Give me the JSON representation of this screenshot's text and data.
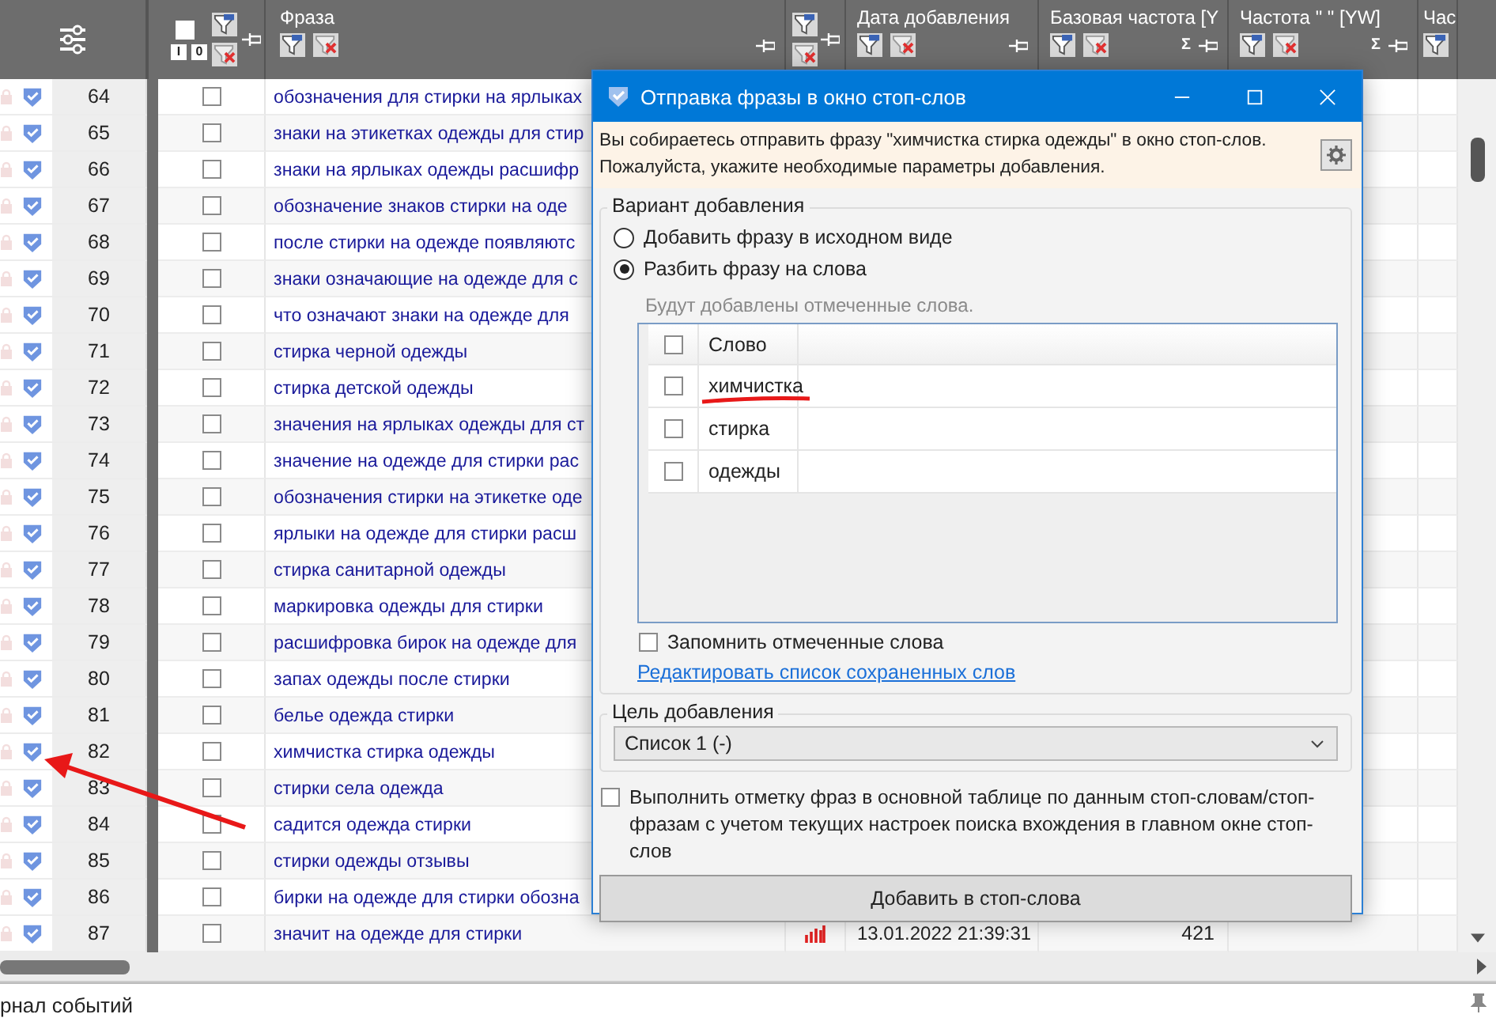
{
  "main_table": {
    "check_header": {
      "checked": false,
      "buttons": [
        "I",
        "0"
      ]
    },
    "columns": [
      {
        "label": "Фраза"
      },
      {
        "label": "Дата добавления"
      },
      {
        "label": "Базовая частота [Y",
        "sum": "Σ"
      },
      {
        "label": "Частота \" \" [YW]",
        "sum": "Σ"
      },
      {
        "label": "Час"
      }
    ],
    "rows": [
      {
        "number": "64",
        "checked": false,
        "phrase": "обозначения для стирки на ярлыках"
      },
      {
        "number": "65",
        "checked": false,
        "phrase": "знаки на этикетках одежды для стир"
      },
      {
        "number": "66",
        "checked": false,
        "phrase": "знаки на ярлыках одежды расшифр"
      },
      {
        "number": "67",
        "checked": false,
        "phrase": "обозначение знаков стирки на оде"
      },
      {
        "number": "68",
        "checked": false,
        "phrase": "после стирки на одежде появляютс"
      },
      {
        "number": "69",
        "checked": false,
        "phrase": "знаки означающие на одежде для с"
      },
      {
        "number": "70",
        "checked": false,
        "phrase": "что означают знаки на одежде для"
      },
      {
        "number": "71",
        "checked": false,
        "phrase": "стирка черной одежды"
      },
      {
        "number": "72",
        "checked": false,
        "phrase": "стирка детской одежды"
      },
      {
        "number": "73",
        "checked": false,
        "phrase": "значения на ярлыках одежды для ст"
      },
      {
        "number": "74",
        "checked": false,
        "phrase": "значение на одежде для стирки рас"
      },
      {
        "number": "75",
        "checked": false,
        "phrase": "обозначения стирки на этикетке оде"
      },
      {
        "number": "76",
        "checked": false,
        "phrase": "ярлыки на одежде для стирки расш"
      },
      {
        "number": "77",
        "checked": false,
        "phrase": "стирка санитарной одежды"
      },
      {
        "number": "78",
        "checked": false,
        "phrase": "маркировка одежды для стирки"
      },
      {
        "number": "79",
        "checked": false,
        "phrase": "расшифровка бирок на одежде для"
      },
      {
        "number": "80",
        "checked": false,
        "phrase": "запах одежды после стирки"
      },
      {
        "number": "81",
        "checked": false,
        "phrase": "белье одежда стирки"
      },
      {
        "number": "82",
        "checked": false,
        "phrase": "химчистка стирка одежды"
      },
      {
        "number": "83",
        "checked": false,
        "phrase": "стирки села одежда"
      },
      {
        "number": "84",
        "checked": false,
        "phrase": "садится одежда стирки"
      },
      {
        "number": "85",
        "checked": false,
        "phrase": "стирки одежды отзывы"
      },
      {
        "number": "86",
        "checked": false,
        "phrase": "бирки на одежде для стирки обозна"
      },
      {
        "number": "87",
        "checked": false,
        "phrase": "значит на одежде для стирки",
        "date": "13.01.2022 21:39:31",
        "base_frequency": "421"
      }
    ]
  },
  "event_log": {
    "title": "рнал событий"
  },
  "dialog": {
    "title": "Отправка фразы в окно стоп-слов",
    "message": "Вы собираетесь отправить фразу \"химчистка стирка одежды\" в окно стоп-слов. Пожалуйста, укажите необходимые параметры добавления.",
    "variant_group": {
      "title": "Вариант добавления",
      "options": [
        {
          "label": "Добавить фразу в исходном виде",
          "selected": false
        },
        {
          "label": "Разбить фразу на слова",
          "selected": true
        }
      ]
    },
    "words_hint": "Будут добавлены отмеченные слова.",
    "words_table": {
      "column": "Слово",
      "all_checked": false,
      "rows": [
        {
          "word": "химчистка",
          "checked": false
        },
        {
          "word": "стирка",
          "checked": false
        },
        {
          "word": "одежды",
          "checked": false
        }
      ]
    },
    "remember": {
      "label": "Запомнить отмеченные слова",
      "checked": false
    },
    "edit_link": "Редактировать список сохраненных слов",
    "target_group": {
      "title": "Цель добавления",
      "value": "Список 1 (-)"
    },
    "mark_option": {
      "label": "Выполнить отметку фраз в основной таблице по данным стоп-словам/стоп-фразам с учетом текущих настроек поиска вхождения в главном окне стоп-слов",
      "checked": false
    },
    "submit": "Добавить в стоп-слова"
  }
}
